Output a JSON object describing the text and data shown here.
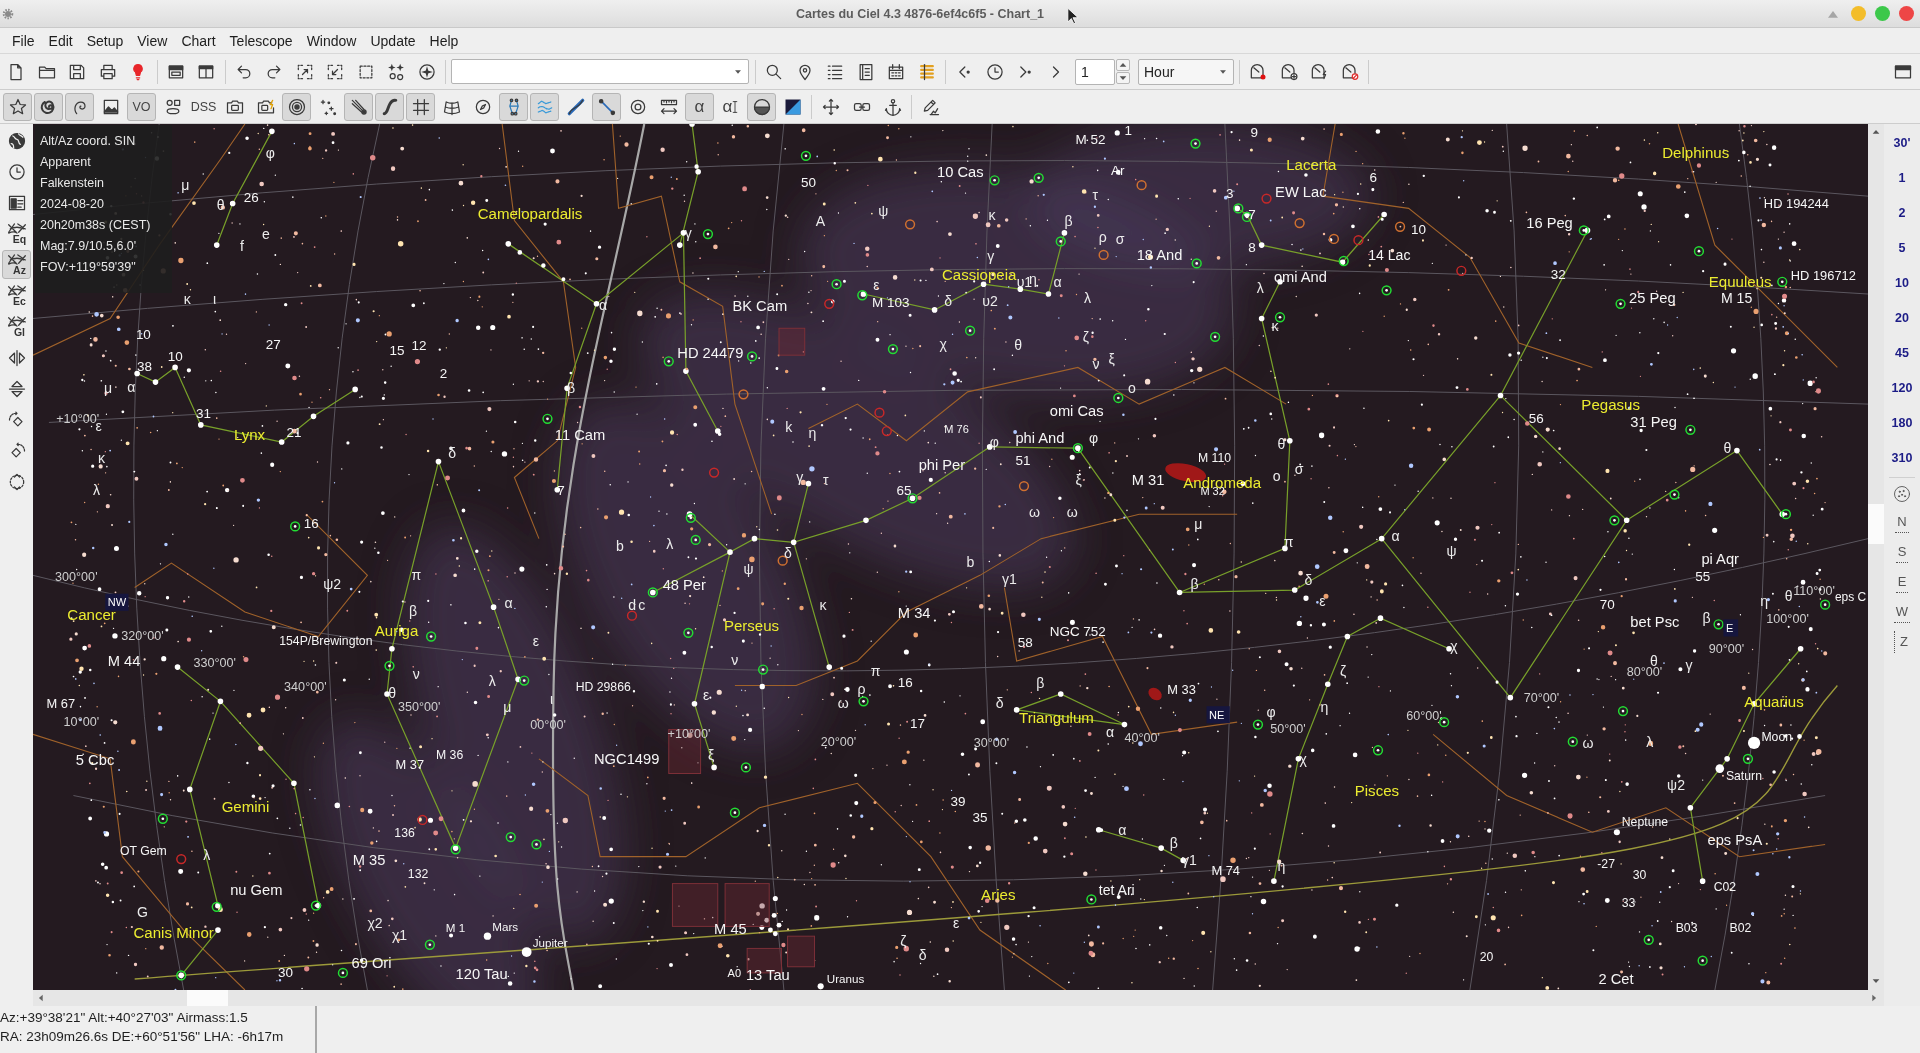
{
  "window": {
    "title": "Cartes du Ciel 4.3 4876-6ef4c6f5 - Chart_1"
  },
  "menu": [
    "File",
    "Edit",
    "Setup",
    "View",
    "Chart",
    "Telescope",
    "Window",
    "Update",
    "Help"
  ],
  "main_toolbar": {
    "step": "1",
    "unit": "Hour"
  },
  "chart_toolbar": [
    {
      "on": true
    },
    {
      "on": true
    },
    {
      "on": true
    },
    {
      "on": false
    },
    {
      "label": "VO",
      "on": true
    },
    {
      "on": false
    },
    {
      "label": "DSS",
      "on": false
    },
    {
      "on": false
    },
    {
      "on": false
    },
    {
      "on": true
    },
    {
      "on": false
    },
    {
      "on": true
    },
    {
      "on": true
    },
    {
      "on": true
    },
    {
      "on": false
    },
    {
      "on": false
    },
    {
      "on": true
    },
    {
      "on": true
    },
    {
      "on": false
    },
    {
      "on": true
    },
    {
      "on": false
    },
    {
      "on": false
    },
    {
      "label": "α",
      "on": true
    },
    {
      "label": "α",
      "on": false
    },
    {
      "on": true
    },
    {
      "on": false
    },
    {
      "on": false
    },
    {
      "on": false
    },
    {
      "on": false
    },
    {
      "on": false
    }
  ],
  "left_toolbar": [
    {
      "on": false
    },
    {
      "on": false
    },
    {
      "on": false
    },
    {
      "label": "Eq",
      "on": false
    },
    {
      "label": "Az",
      "on": true
    },
    {
      "label": "Ec",
      "on": false
    },
    {
      "label": "Gl",
      "on": false
    },
    {
      "on": false
    },
    {
      "on": false
    },
    {
      "on": false
    },
    {
      "on": false
    },
    {
      "on": false
    }
  ],
  "chart": {
    "info": [
      "Alt/Az coord. SIN",
      "Apparent",
      "Falkenstein",
      "2024-08-20",
      "20h20m38s (CEST)",
      "Mag:7.9/10.5,6.0'",
      "FOV:+119°59'39\""
    ],
    "constellation_labels": [
      "Lacerta",
      "Delphinus",
      "Camelopardalis",
      "Cassiopeia",
      "Equuleus",
      "Pegasus",
      "Lynx",
      "Andromeda",
      "Cancer",
      "Auriga",
      "Perseus",
      "Triangulum",
      "Aquarius",
      "Gemini",
      "Pisces",
      "Aries",
      "Canis Minor"
    ],
    "object_labels": [
      "M 52",
      "1",
      "9",
      "50",
      "10 Cas",
      "Ar",
      "6",
      "26",
      "3",
      "EW Lac",
      "7",
      "HD 194244",
      "10",
      "16 Peg",
      "18 And",
      "8",
      "14 Lac",
      "omi And",
      "32",
      "HD 196712",
      "BK Cam",
      "M 103",
      "25 Peg",
      "M 15",
      "10",
      "10",
      "27",
      "15",
      "12",
      "HD 24479",
      "38",
      "2",
      "31",
      "21",
      "11 Cam",
      "M 76",
      "omi Cas",
      "phi And",
      "56",
      "31 Peg",
      "phi Per",
      "51",
      "M 110",
      "7",
      "65",
      "M 31",
      "M 32",
      "16",
      "48 Per",
      "pi Aqr",
      "55",
      "M 34",
      "70",
      "bet Psc",
      "eps C",
      "M 44",
      "154P/Brewington",
      "58",
      "NGC 752",
      "M 67",
      "HD 29866",
      "16",
      "M 33",
      "17",
      "5 Cbc",
      "M 37",
      "M 36",
      "NGC1499",
      "Moon",
      "Saturn",
      "39",
      "35",
      "Neptune",
      "OT Gem",
      "136",
      "eps PsA",
      "nu Gem",
      "M 35",
      "132",
      "tet Ari",
      "M 74",
      "-27",
      "30",
      "C02",
      "33",
      "M 1",
      "Mars",
      "Jupiter",
      "M 45",
      "B03",
      "B02",
      "30",
      "69 Ori",
      "120 Tau",
      "A0",
      "13 Tau",
      "Uranus",
      "20",
      "2 Cet"
    ],
    "star_labels": [
      "φ",
      "μ",
      "θ",
      "τ",
      "A",
      "ψ",
      "κ",
      "β",
      "f",
      "e",
      "γ",
      "ρ",
      "σ",
      "γ",
      "κ",
      "ι",
      "α",
      "ε",
      "δ",
      "υ2",
      "υ1",
      "η",
      "α",
      "λ",
      "λ",
      "κ",
      "χ",
      "θ",
      "ζ",
      "ν",
      "ξ",
      "μ",
      "α",
      "β",
      "ο",
      "ε",
      "k",
      "η",
      "κ",
      "δ",
      "φ",
      "φ",
      "θ",
      "θ",
      "γ",
      "τ",
      "ξ",
      "ο",
      "σ",
      "λ",
      "ω",
      "ω",
      "μ",
      "b",
      "λ",
      "δ",
      "b",
      "π",
      "α",
      "ψ",
      "ψ2",
      "π",
      "ψ",
      "γ1",
      "β",
      "δ",
      "β",
      "α",
      "d",
      "c",
      "κ",
      "ε",
      "η",
      "θ",
      "β",
      "ε",
      "χ",
      "ν",
      "ν",
      "π",
      "ζ",
      "θ",
      "γ",
      "θ",
      "λ",
      "μ",
      "ι",
      "ε",
      "ω",
      "ρ",
      "δ",
      "β",
      "φ",
      "η",
      "α",
      "ω",
      "λ",
      "ξ",
      "χ",
      "ψ2",
      "α",
      "λ",
      "β",
      "γ1",
      "η",
      "G",
      "χ2",
      "χ1",
      "ζ",
      "ε",
      "δ"
    ],
    "grid_labels": [
      "+10°00'",
      "300°00'",
      "110°00'",
      "100°00'",
      "320°00'",
      "330°00'",
      "80°00'",
      "90°00'",
      "10°00'",
      "340°00'",
      "350°00'",
      "00°00'",
      "+10°00'",
      "20°00'",
      "30°00'",
      "40°00'",
      "50°00'",
      "60°00'",
      "70°00'"
    ],
    "direction_labels": [
      "NW",
      "E",
      "NE"
    ]
  },
  "zoom_buttons": [
    "30'",
    "1",
    "2",
    "5",
    "10",
    "20",
    "45",
    "120",
    "180",
    "310"
  ],
  "orientation_buttons": [
    "N",
    "S",
    "E",
    "W",
    "Z"
  ],
  "status_bar": [
    "Az:+39°38'21\" Alt:+40°27'03\" Airmass:1.5",
    "RA: 23h09m26.6s DE:+60°51'56\" LHA: -6h17m"
  ]
}
